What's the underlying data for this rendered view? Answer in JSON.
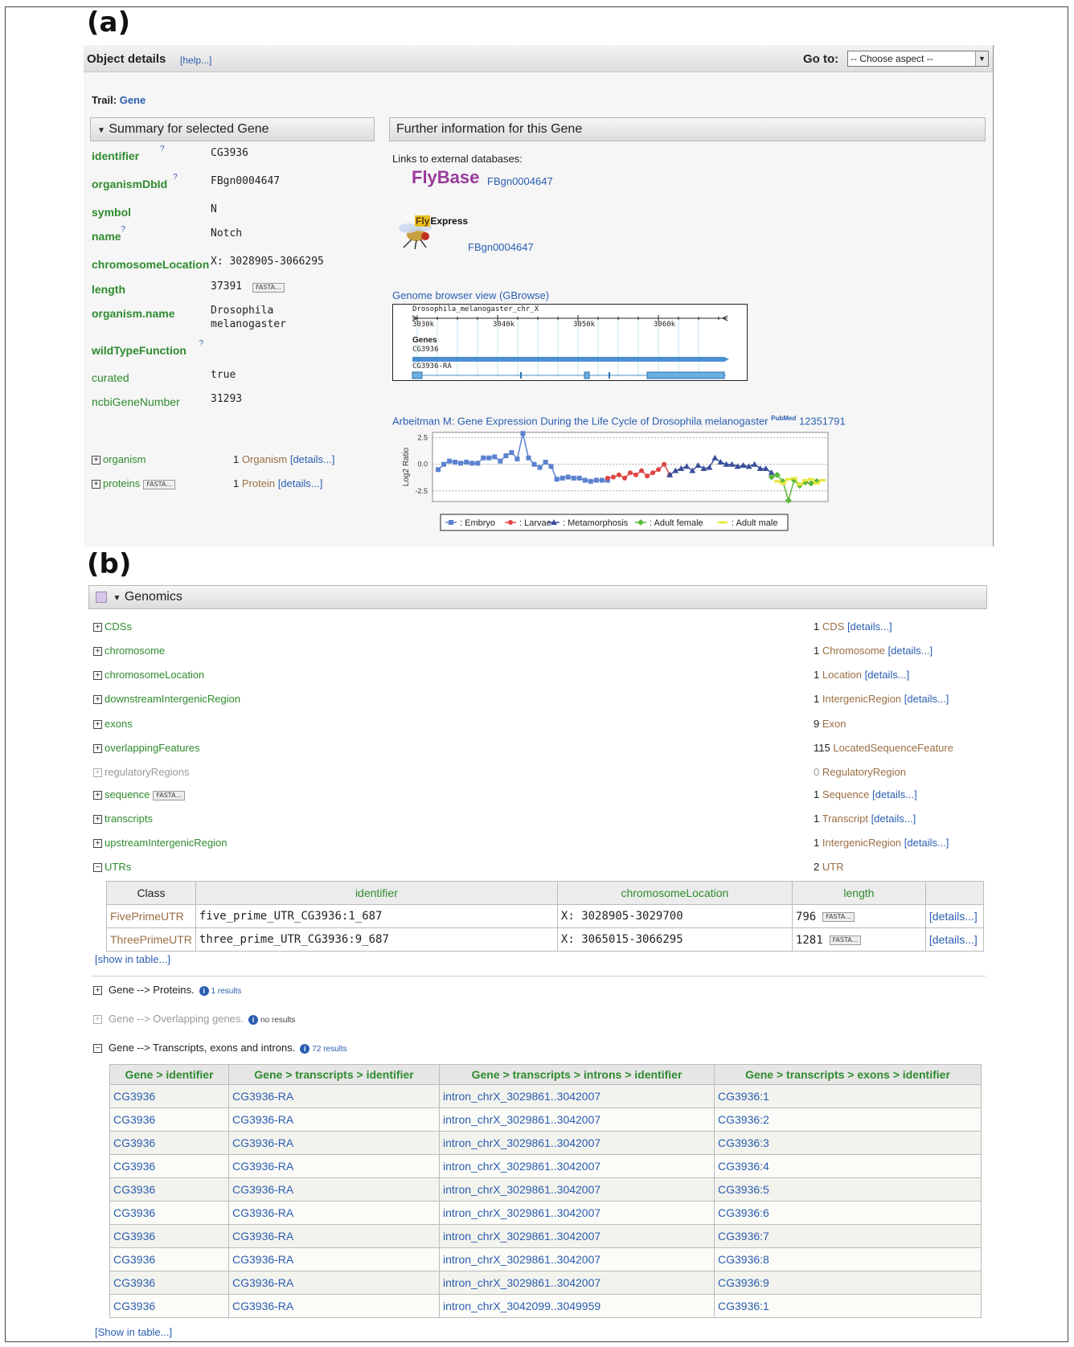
{
  "panel_a": {
    "label": "(a)",
    "header": {
      "title": "Object details",
      "help": "[help...]",
      "goto_label": "Go to:",
      "select_value": "-- Choose aspect --"
    },
    "trail": {
      "label": "Trail:",
      "link": "Gene"
    },
    "summary": {
      "title": "Summary for selected Gene",
      "fields": [
        {
          "name": "identifier",
          "value": "CG3936",
          "help": "?"
        },
        {
          "name": "organismDbId",
          "value": "FBgn0004647",
          "help": "?"
        },
        {
          "name": "symbol",
          "value": "N"
        },
        {
          "name": "name",
          "value": "Notch",
          "help": "?"
        },
        {
          "name": "chromosomeLocation",
          "value": "X: 3028905-3066295"
        },
        {
          "name": "length",
          "value": "37391",
          "fasta": "FASTA..."
        },
        {
          "name": "organism.name",
          "value": "Drosophila\nmelanogaster"
        },
        {
          "name": "wildTypeFunction",
          "value": "",
          "help": "?"
        },
        {
          "name": "curated",
          "value": "true"
        },
        {
          "name": "ncbiGeneNumber",
          "value": "31293"
        }
      ],
      "collections": [
        {
          "name": "organism",
          "count": "1",
          "type": "Organism",
          "details": "[details...]"
        },
        {
          "name": "proteins",
          "fasta": "FASTA...",
          "count": "1",
          "type": "Protein",
          "details": "[details...]"
        }
      ]
    },
    "further": {
      "title": "Further information for this Gene",
      "links_label": "Links to external databases:",
      "flybase_logo": "FlyBase",
      "flybase_id": "FBgn0004647",
      "flyexpress_logo_fly": "Fly",
      "flyexpress_logo": "Express",
      "flyexpress_id": "FBgn0004647",
      "gbrowse_title": "Genome browser view (GBrowse)",
      "gbrowse": {
        "chrom": "Drosophila_melanogaster_chr_X",
        "ticks": [
          "3030k",
          "3040k",
          "3050k",
          "3060k"
        ],
        "track": "Genes",
        "gene": "CG3936",
        "transcript": "CG3936-RA"
      },
      "pub_title": "Arbeitman M: Gene Expression During the Life Cycle of Drosophila melanogaster",
      "pubmed_badge": "PubMed",
      "pub_id": "12351791"
    }
  },
  "chart_data": {
    "type": "line",
    "title": "",
    "xlabel": "",
    "ylabel": "Log2 Ratio",
    "ylim": [
      -3.5,
      3.0
    ],
    "yticks": [
      "2.5",
      "0.0",
      "-2.5"
    ],
    "grid": true,
    "legend_position": "bottom",
    "series": [
      {
        "name": "Embryo",
        "color": "#5b82cf",
        "marker": "square",
        "x": [
          1,
          2,
          3,
          4,
          5,
          6,
          7,
          8,
          9,
          10,
          11,
          12,
          13,
          14,
          15,
          16,
          17,
          18,
          19,
          20,
          21,
          22,
          23,
          24,
          25,
          26,
          27,
          28,
          29,
          30,
          31
        ],
        "values": [
          -0.5,
          0.0,
          0.3,
          0.2,
          0.1,
          0.2,
          0.1,
          0.1,
          0.6,
          0.6,
          0.7,
          0.3,
          0.8,
          1.1,
          0.5,
          2.9,
          0.6,
          0.0,
          -0.3,
          0.2,
          -0.2,
          -1.4,
          -1.3,
          -1.2,
          -1.3,
          -1.3,
          -1.5,
          -1.6,
          -1.5,
          -1.5,
          -1.5
        ]
      },
      {
        "name": "Larvae",
        "color": "#e04444",
        "marker": "circle",
        "x": [
          31,
          32,
          33,
          34,
          35,
          36,
          37,
          38,
          39,
          40,
          41,
          42
        ],
        "values": [
          -1.3,
          -1.2,
          -1.0,
          -1.3,
          -0.8,
          -1.0,
          -0.6,
          -1.1,
          -0.8,
          -0.5,
          0.0,
          -1.0
        ]
      },
      {
        "name": "Metamorphosis",
        "color": "#3a4f9c",
        "marker": "triangle",
        "x": [
          42,
          43,
          44,
          45,
          46,
          47,
          48,
          49,
          50,
          51,
          52,
          53,
          54,
          55,
          56,
          57,
          58,
          59,
          60
        ],
        "values": [
          -1.0,
          -0.6,
          -0.4,
          -0.2,
          -0.6,
          -0.1,
          -0.4,
          -0.3,
          0.6,
          0.2,
          0.0,
          0.0,
          -0.2,
          -0.1,
          -0.2,
          0.0,
          -0.4,
          -0.4,
          -0.8
        ]
      },
      {
        "name": "Adult female",
        "color": "#5cb83a",
        "marker": "diamond",
        "x": [
          60,
          61,
          62,
          63,
          64,
          65,
          66,
          67,
          68
        ],
        "values": [
          -1.2,
          -1.0,
          -1.6,
          -3.4,
          -1.5,
          -2.0,
          -1.7,
          -1.8,
          -1.6
        ]
      },
      {
        "name": "Adult male",
        "color": "#e8e83a",
        "marker": "cross",
        "x": [
          61,
          62,
          63,
          64,
          65,
          66,
          67,
          68,
          69
        ],
        "values": [
          -1.6,
          -1.8,
          -1.4,
          -1.3,
          -1.9,
          -1.5,
          -1.4,
          -1.8,
          -1.5
        ]
      }
    ]
  },
  "panel_b": {
    "label": "(b)",
    "genomics_title": "Genomics",
    "collections": [
      {
        "name": "CDSs",
        "count": "1",
        "type": "CDS",
        "details": "[details...]"
      },
      {
        "name": "chromosome",
        "count": "1",
        "type": "Chromosome",
        "details": "[details...]"
      },
      {
        "name": "chromosomeLocation",
        "count": "1",
        "type": "Location",
        "details": "[details...]"
      },
      {
        "name": "downstreamIntergenicRegion",
        "count": "1",
        "type": "IntergenicRegion",
        "details": "[details...]"
      },
      {
        "name": "exons",
        "count": "9",
        "type": "Exon",
        "details": ""
      },
      {
        "name": "overlappingFeatures",
        "count": "115",
        "type": "LocatedSequenceFeature",
        "details": ""
      },
      {
        "name": "regulatoryRegions",
        "count": "0",
        "type": "RegulatoryRegion",
        "details": ""
      },
      {
        "name": "sequence",
        "fasta": "FASTA...",
        "count": "1",
        "type": "Sequence",
        "details": "[details...]"
      },
      {
        "name": "transcripts",
        "count": "1",
        "type": "Transcript",
        "details": "[details...]"
      },
      {
        "name": "upstreamIntergenicRegion",
        "count": "1",
        "type": "IntergenicRegion",
        "details": "[details...]"
      },
      {
        "name": "UTRs",
        "count": "2",
        "type": "UTR",
        "details": ""
      }
    ],
    "utr_table": {
      "headers": [
        "Class",
        "identifier",
        "chromosomeLocation",
        "length",
        ""
      ],
      "rows": [
        {
          "class": "FivePrimeUTR",
          "identifier": "five_prime_UTR_CG3936:1_687",
          "location": "X: 3028905-3029700",
          "length": "796",
          "fasta": "FASTA...",
          "details": "[details...]"
        },
        {
          "class": "ThreePrimeUTR",
          "identifier": "three_prime_UTR_CG3936:9_687",
          "location": "X: 3065015-3066295",
          "length": "1281",
          "fasta": "FASTA...",
          "details": "[details...]"
        }
      ],
      "show_link": "[show in table...]"
    },
    "templates": [
      {
        "text": "Gene --> Proteins.",
        "results": "1 results"
      },
      {
        "text": "Gene --> Overlapping genes.",
        "results": "no results"
      },
      {
        "text": "Gene --> Transcripts, exons and introns.",
        "results": "72 results"
      }
    ],
    "result_table": {
      "headers": [
        "Gene > identifier",
        "Gene > transcripts > identifier",
        "Gene > transcripts > introns > identifier",
        "Gene > transcripts > exons > identifier"
      ],
      "rows": [
        [
          "CG3936",
          "CG3936-RA",
          "intron_chrX_3029861..3042007",
          "CG3936:1"
        ],
        [
          "CG3936",
          "CG3936-RA",
          "intron_chrX_3029861..3042007",
          "CG3936:2"
        ],
        [
          "CG3936",
          "CG3936-RA",
          "intron_chrX_3029861..3042007",
          "CG3936:3"
        ],
        [
          "CG3936",
          "CG3936-RA",
          "intron_chrX_3029861..3042007",
          "CG3936:4"
        ],
        [
          "CG3936",
          "CG3936-RA",
          "intron_chrX_3029861..3042007",
          "CG3936:5"
        ],
        [
          "CG3936",
          "CG3936-RA",
          "intron_chrX_3029861..3042007",
          "CG3936:6"
        ],
        [
          "CG3936",
          "CG3936-RA",
          "intron_chrX_3029861..3042007",
          "CG3936:7"
        ],
        [
          "CG3936",
          "CG3936-RA",
          "intron_chrX_3029861..3042007",
          "CG3936:8"
        ],
        [
          "CG3936",
          "CG3936-RA",
          "intron_chrX_3029861..3042007",
          "CG3936:9"
        ],
        [
          "CG3936",
          "CG3936-RA",
          "intron_chrX_3042099..3049959",
          "CG3936:1"
        ]
      ],
      "show_link": "[Show in table...]"
    }
  }
}
